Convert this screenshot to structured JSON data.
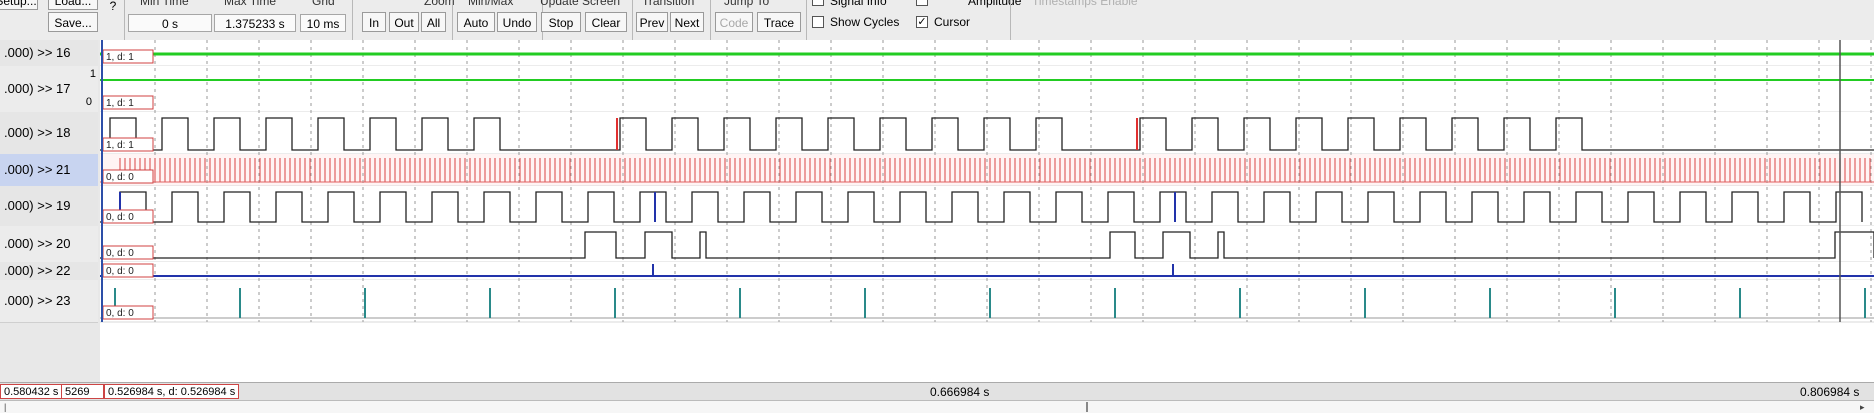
{
  "toolbar": {
    "setup_label": "Setup...",
    "load_label": "Load...",
    "save_label": "Save...",
    "question_label": "?",
    "min_time": {
      "label": "Min Time",
      "value": "0 s"
    },
    "max_time": {
      "label": "Max Time",
      "value": "1.375233 s"
    },
    "grid": {
      "label": "Grid",
      "value": "10 ms"
    },
    "zoom": {
      "label": "Zoom",
      "buttons": [
        "In",
        "Out",
        "All"
      ]
    },
    "minmax": {
      "label": "Min/Max",
      "buttons": [
        "Auto",
        "Undo"
      ]
    },
    "update_screen": {
      "label": "Update Screen",
      "buttons": [
        "Stop",
        "Clear"
      ]
    },
    "transition": {
      "label": "Transition",
      "buttons": [
        "Prev",
        "Next"
      ]
    },
    "jump_to": {
      "label": "Jump To",
      "buttons": [
        "Code",
        "Trace"
      ]
    },
    "signal_info": {
      "label": "Signal Info",
      "checked": false
    },
    "amplitude": {
      "label": "Amplitude",
      "checked": false
    },
    "timestamps": {
      "label": "Timestamps Enable",
      "checked": false
    },
    "show_cycles": {
      "label": "Show Cycles",
      "checked": false
    },
    "cursor": {
      "label": "Cursor",
      "checked": true
    }
  },
  "signals": [
    {
      "name": ".000) >> 16",
      "tag": "1,  d: 1",
      "level": "high",
      "color": "#22cc22"
    },
    {
      "name": ".000) >> 17",
      "tag": "1,  d: 1",
      "level": "scale",
      "scale_top": "1",
      "scale_bottom": "0",
      "color": "#22cc22"
    },
    {
      "name": ".000) >> 18",
      "tag": "1,  d: 1",
      "level": "clock",
      "color": "#333333"
    },
    {
      "name": ".000) >> 21",
      "tag": "0,  d: 0",
      "level": "dense",
      "color": "#e03030"
    },
    {
      "name": ".000) >> 19",
      "tag": "0,  d: 0",
      "level": "clock",
      "color": "#333333"
    },
    {
      "name": ".000) >> 20",
      "tag": "0,  d: 0",
      "level": "pulses",
      "color": "#333333"
    },
    {
      "name": ".000) >> 22",
      "tag": "0,  d: 0",
      "level": "low",
      "color": "#2233aa"
    },
    {
      "name": ".000) >> 23",
      "tag": "0,  d: 0",
      "level": "spikes",
      "color": "#2a8a8a"
    }
  ],
  "status": {
    "left_value": "0.580432 s",
    "left_value2": "5269",
    "cursor_value": "0.526984 s,  d: 0.526984 s",
    "mid_time": "0.666984 s",
    "right_time": "0.806984 s"
  }
}
